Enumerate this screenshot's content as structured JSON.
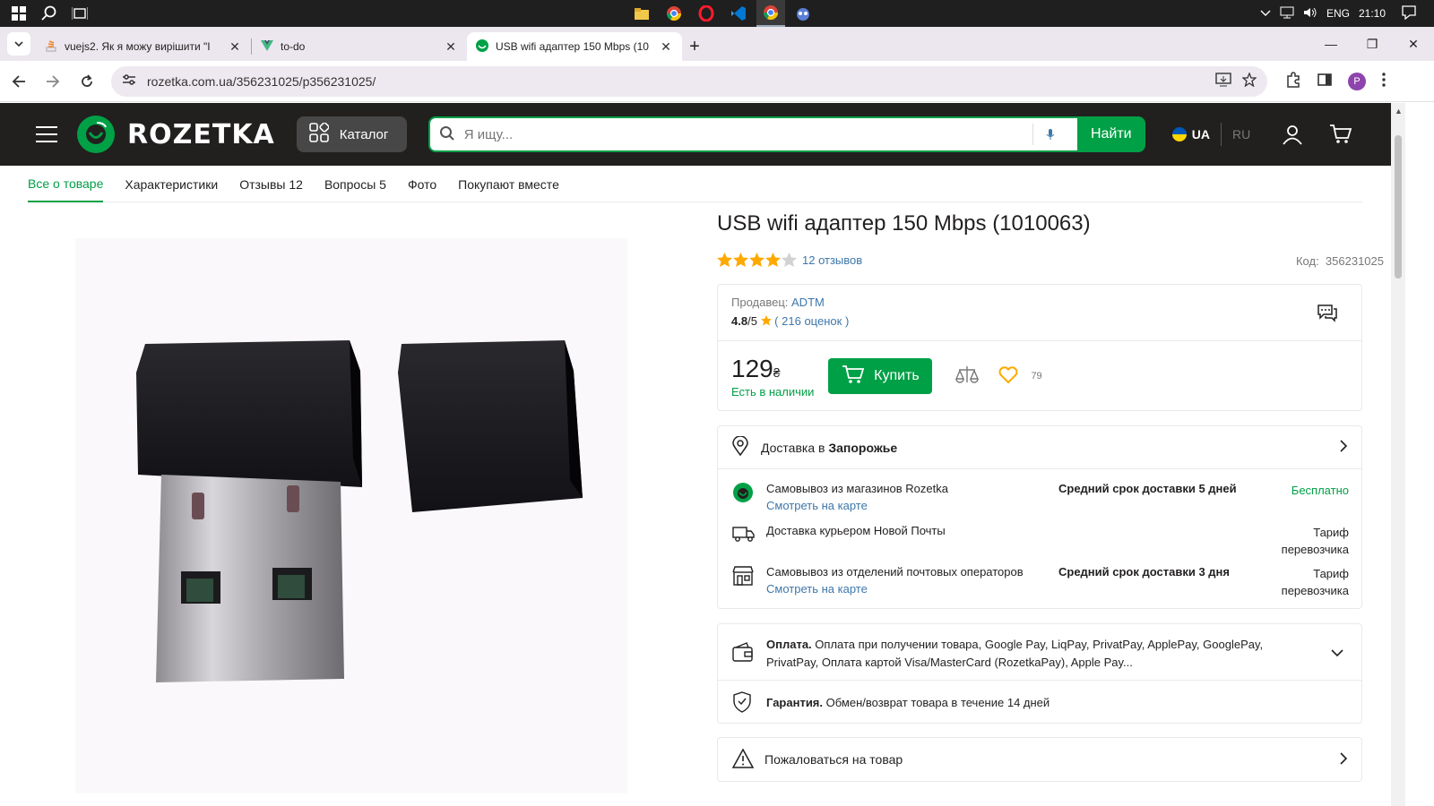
{
  "taskbar": {
    "lang": "ENG",
    "time": "21:10"
  },
  "browser": {
    "tabs": [
      {
        "title": "vuejs2. Як я можу вирішити \"I"
      },
      {
        "title": "to-do"
      },
      {
        "title": "USB wifi адаптер 150 Mbps (10"
      }
    ],
    "url": "rozetka.com.ua/356231025/p356231025/",
    "profile_initial": "P"
  },
  "header": {
    "logo": "ROZETKA",
    "catalog": "Каталог",
    "search_placeholder": "Я ищу...",
    "search_button": "Найти",
    "lang_ua": "UA",
    "lang_ru": "RU"
  },
  "product_tabs": [
    {
      "label": "Все о товаре"
    },
    {
      "label": "Характеристики"
    },
    {
      "label": "Отзывы 12"
    },
    {
      "label": "Вопросы 5"
    },
    {
      "label": "Фото"
    },
    {
      "label": "Покупают вместе"
    }
  ],
  "product": {
    "title": "USB wifi адаптер 150 Mbps (1010063)",
    "reviews_link": "12 отзывов",
    "rating_stars": 4,
    "code_label": "Код:",
    "code": "356231025"
  },
  "seller": {
    "label": "Продавец:",
    "name": "ADTM",
    "score": "4.8",
    "score_max": "/5",
    "ratings_count": "216 оценок",
    "paren_open": "(",
    "paren_close": ")"
  },
  "buy": {
    "price": "129",
    "currency": "₴",
    "availability": "Есть в наличии",
    "buy_label": "Купить",
    "favorites_count": "79"
  },
  "delivery": {
    "header_prefix": "Доставка в",
    "city": "Запорожье",
    "options": [
      {
        "name": "Самовывоз из магазинов Rozetka",
        "link": "Смотреть на карте",
        "term": "Средний срок доставки 5 дней",
        "price": "Бесплатно"
      },
      {
        "name": "Доставка курьером Новой Почты",
        "link": "",
        "term": "",
        "price_line1": "Тариф",
        "price_line2": "перевозчика"
      },
      {
        "name": "Самовывоз из отделений почтовых операторов",
        "link": "Смотреть на карте",
        "term": "Средний срок доставки 3 дня",
        "price_line1": "Тариф",
        "price_line2": "перевозчика"
      }
    ]
  },
  "payment": {
    "label": "Оплата.",
    "text": "Оплата при получении товара, Google Pay, LiqPay, PrivatPay, ApplePay, GooglePay, PrivatPay, Оплата картой Visa/MasterCard (RozetkaPay), Apple Pay..."
  },
  "warranty": {
    "label": "Гарантия.",
    "text": "Обмен/возврат товара в течение 14 дней"
  },
  "complain": "Пожаловаться на товар",
  "colors": {
    "brand_green": "#00a046",
    "header_dark": "#221f1f",
    "link_blue": "#3e77aa",
    "star_gold": "#ffa900"
  }
}
